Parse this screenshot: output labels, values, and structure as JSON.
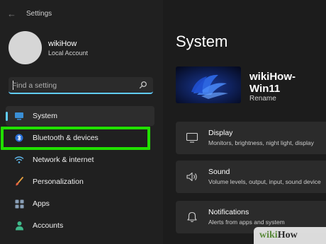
{
  "window": {
    "back_icon": "back-arrow-icon",
    "title": "Settings"
  },
  "account": {
    "name": "wikiHow",
    "type": "Local Account"
  },
  "search": {
    "placeholder": "Find a setting",
    "icon": "search-icon"
  },
  "nav": {
    "items": [
      {
        "label": "System",
        "icon": "display-icon",
        "active": true
      },
      {
        "label": "Bluetooth & devices",
        "icon": "bluetooth-icon",
        "active": false
      },
      {
        "label": "Network & internet",
        "icon": "wifi-icon",
        "active": false
      },
      {
        "label": "Personalization",
        "icon": "brush-icon",
        "active": false
      },
      {
        "label": "Apps",
        "icon": "apps-icon",
        "active": false
      },
      {
        "label": "Accounts",
        "icon": "person-icon",
        "active": false
      }
    ]
  },
  "main": {
    "title": "System",
    "device": {
      "name": "wikiHow-Win11",
      "rename": "Rename"
    },
    "cards": [
      {
        "title": "Display",
        "subtitle": "Monitors, brightness, night light, display",
        "icon": "monitor-icon"
      },
      {
        "title": "Sound",
        "subtitle": "Volume levels, output, input, sound device",
        "icon": "speaker-icon"
      },
      {
        "title": "Notifications",
        "subtitle": "Alerts from apps and system",
        "icon": "bell-icon"
      }
    ]
  },
  "watermark": {
    "wiki": "wiki",
    "how": "How"
  },
  "colors": {
    "accent": "#60cdff",
    "highlight": "#21e000",
    "background": "#202020",
    "card": "#2b2b2b"
  }
}
